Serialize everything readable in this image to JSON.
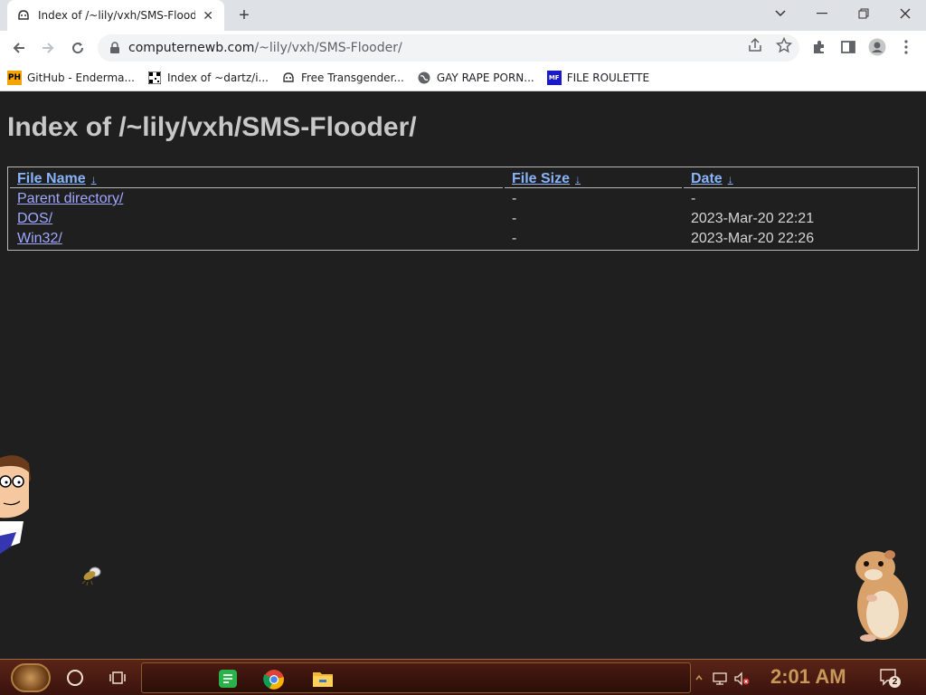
{
  "browser": {
    "tab_title": "Index of /~lily/vxh/SMS-Flooder/",
    "url_host": "computernewb.com",
    "url_path": "/~lily/vxh/SMS-Flooder/",
    "bookmarks": [
      {
        "label": "GitHub - Enderma...",
        "icon": "PH"
      },
      {
        "label": "Index of ~dartz/i...",
        "icon": "qr"
      },
      {
        "label": "Free Transgender...",
        "icon": "mask"
      },
      {
        "label": "GAY RAPE PORN...",
        "icon": "globe"
      },
      {
        "label": "FILE ROULETTE",
        "icon": "MF"
      }
    ]
  },
  "page": {
    "heading": "Index of /~lily/vxh/SMS-Flooder/",
    "columns": {
      "name": "File Name",
      "size": "File Size",
      "date": "Date",
      "sort_arrow": "↓"
    },
    "rows": [
      {
        "name": "Parent directory/",
        "size": "-",
        "date": "-"
      },
      {
        "name": "DOS/",
        "size": "-",
        "date": "2023-Mar-20 22:21"
      },
      {
        "name": "Win32/",
        "size": "-",
        "date": "2023-Mar-20 22:26"
      }
    ]
  },
  "taskbar": {
    "clock": "2:01 AM",
    "notification_count": "2"
  },
  "colors": {
    "page_bg": "#1f1f1f",
    "link": "#8ab4f8",
    "heading": "#c8c8c8",
    "clock": "#c89858"
  }
}
